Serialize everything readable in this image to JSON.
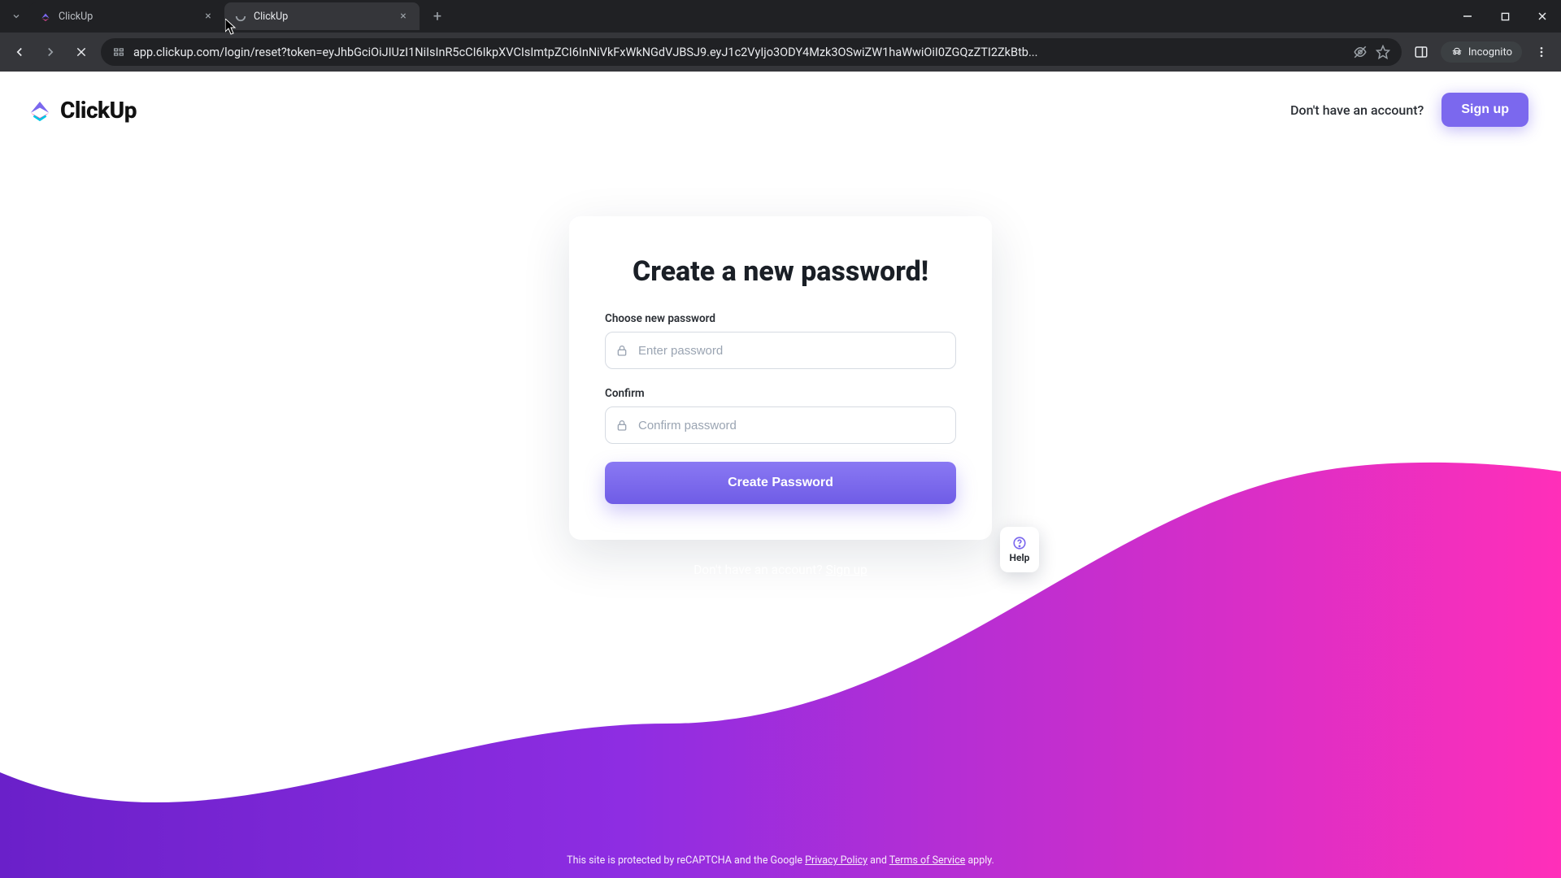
{
  "browser": {
    "tabs": [
      {
        "title": "ClickUp",
        "active": false
      },
      {
        "title": "ClickUp",
        "active": true
      }
    ],
    "url": "app.clickup.com/login/reset?token=eyJhbGciOiJIUzI1NiIsInR5cCI6IkpXVCIsImtpZCI6InNiVkFxWkNGdVJBSJ9.eyJ1c2VyIjo3ODY4Mzk3OSwiZW1haWwiOiI0ZGQzZTI2ZkBtb...",
    "incognito_label": "Incognito"
  },
  "header": {
    "brand": "ClickUp",
    "question": "Don't have an account?",
    "signup_label": "Sign up"
  },
  "form": {
    "title": "Create a new password!",
    "new_label": "Choose new password",
    "new_placeholder": "Enter password",
    "confirm_label": "Confirm",
    "confirm_placeholder": "Confirm password",
    "submit_label": "Create Password"
  },
  "help": {
    "label": "Help"
  },
  "below": {
    "question": "Don't have an account? ",
    "signup": "Sign up"
  },
  "legal": {
    "prefix": "This site is protected by reCAPTCHA and the Google ",
    "privacy": "Privacy Policy",
    "and": " and ",
    "terms": "Terms of Service",
    "suffix": " apply."
  },
  "colors": {
    "brand_purple": "#7b68ee",
    "gradient_pink": "#e54cc0",
    "gradient_violet": "#7b2ff7"
  }
}
